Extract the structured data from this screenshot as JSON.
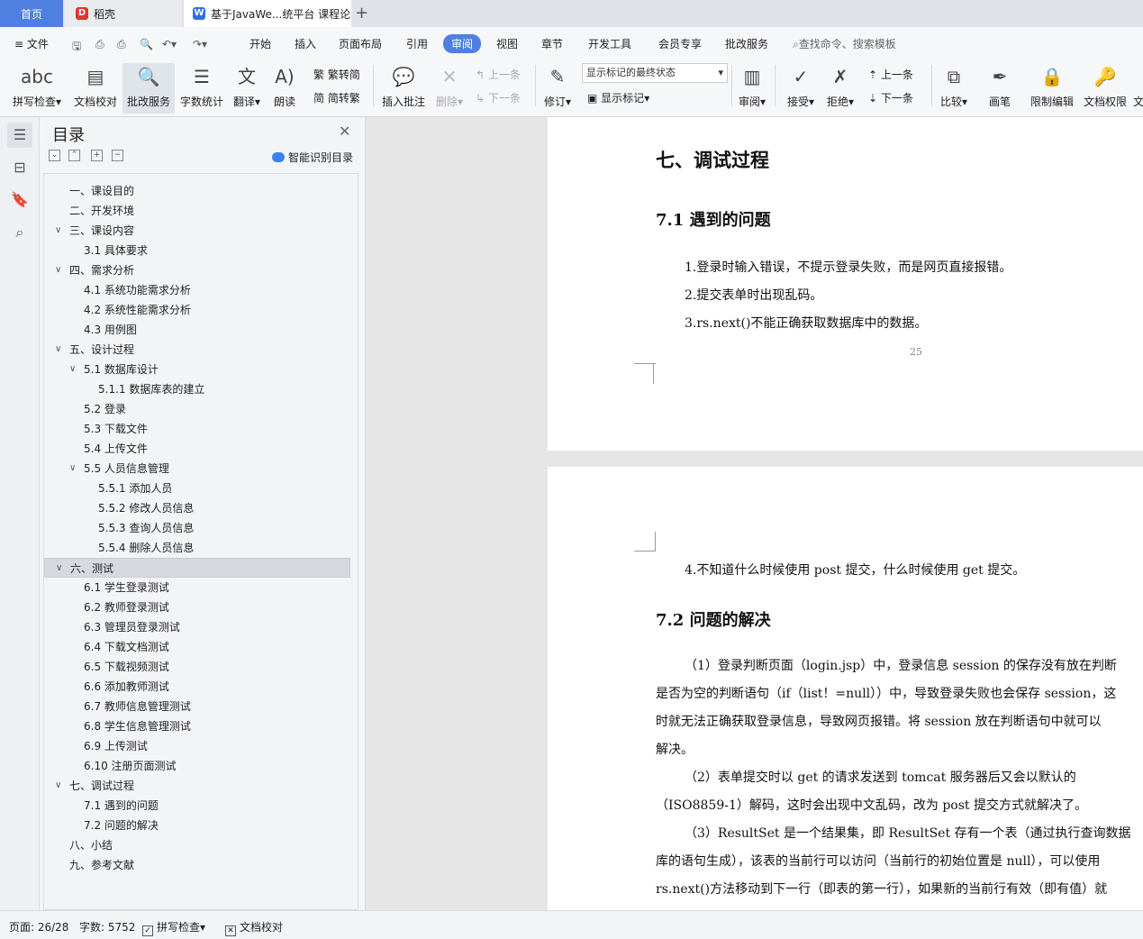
{
  "tabs": {
    "home": "首页",
    "daoke": "稻壳",
    "document": "基于JavaWe...统平台 课程论",
    "new_tab": "+"
  },
  "menu": {
    "file": "文件",
    "items": [
      "开始",
      "插入",
      "页面布局",
      "引用",
      "审阅",
      "视图",
      "章节",
      "开发工具",
      "会员专享",
      "批改服务"
    ],
    "active": "审阅",
    "search_placeholder": "查找命令、搜索模板"
  },
  "ribbon": {
    "spell_check": "拼写检查",
    "doc_proof": "文档校对",
    "correction_service": "批改服务",
    "word_count": "字数统计",
    "translate": "翻译",
    "read_aloud": "朗读",
    "trad_to_simp": "繁转简",
    "simp_to_trad": "简转繁",
    "insert_comment": "插入批注",
    "delete": "删除",
    "prev_item": "上一条",
    "next_item": "下一条",
    "revise": "修订",
    "markup_state": "显示标记的最终状态",
    "show_markup": "显示标记",
    "review": "审阅",
    "accept": "接受",
    "reject": "拒绝",
    "prev": "上一条",
    "next": "下一条",
    "compare": "比较",
    "pen": "画笔",
    "restrict_edit": "限制编辑",
    "doc_permission": "文档权限",
    "cut_off": "文"
  },
  "nav": {
    "title": "目录",
    "smart_toc": "智能识别目录",
    "items": [
      {
        "label": "一、课设目的",
        "level": 1,
        "caret": false
      },
      {
        "label": "二、开发环境",
        "level": 1,
        "caret": false
      },
      {
        "label": "三、课设内容",
        "level": 1,
        "caret": true
      },
      {
        "label": "3.1 具体要求",
        "level": 2,
        "caret": false
      },
      {
        "label": "四、需求分析",
        "level": 1,
        "caret": true
      },
      {
        "label": "4.1 系统功能需求分析",
        "level": 2,
        "caret": false
      },
      {
        "label": "4.2 系统性能需求分析",
        "level": 2,
        "caret": false
      },
      {
        "label": "4.3 用例图",
        "level": 2,
        "caret": false
      },
      {
        "label": "五、设计过程",
        "level": 1,
        "caret": true
      },
      {
        "label": "5.1 数据库设计",
        "level": 2,
        "caret": true
      },
      {
        "label": "5.1.1 数据库表的建立",
        "level": 3,
        "caret": false
      },
      {
        "label": "5.2 登录",
        "level": 2,
        "caret": false
      },
      {
        "label": "5.3 下载文件",
        "level": 2,
        "caret": false
      },
      {
        "label": "5.4 上传文件",
        "level": 2,
        "caret": false
      },
      {
        "label": "5.5 人员信息管理",
        "level": 2,
        "caret": true
      },
      {
        "label": "5.5.1 添加人员",
        "level": 3,
        "caret": false
      },
      {
        "label": "5.5.2 修改人员信息",
        "level": 3,
        "caret": false
      },
      {
        "label": "5.5.3 查询人员信息",
        "level": 3,
        "caret": false
      },
      {
        "label": "5.5.4 删除人员信息",
        "level": 3,
        "caret": false
      },
      {
        "label": "六、测试",
        "level": 1,
        "caret": true,
        "selected": true
      },
      {
        "label": "6.1 学生登录测试",
        "level": 2,
        "caret": false
      },
      {
        "label": "6.2 教师登录测试",
        "level": 2,
        "caret": false
      },
      {
        "label": "6.3 管理员登录测试",
        "level": 2,
        "caret": false
      },
      {
        "label": "6.4 下载文档测试",
        "level": 2,
        "caret": false
      },
      {
        "label": "6.5 下载视频测试",
        "level": 2,
        "caret": false
      },
      {
        "label": "6.6 添加教师测试",
        "level": 2,
        "caret": false
      },
      {
        "label": "6.7 教师信息管理测试",
        "level": 2,
        "caret": false
      },
      {
        "label": "6.8 学生信息管理测试",
        "level": 2,
        "caret": false
      },
      {
        "label": "6.9 上传测试",
        "level": 2,
        "caret": false
      },
      {
        "label": "6.10 注册页面测试",
        "level": 2,
        "caret": false
      },
      {
        "label": "七、调试过程",
        "level": 1,
        "caret": true
      },
      {
        "label": "7.1 遇到的问题",
        "level": 2,
        "caret": false
      },
      {
        "label": "7.2 问题的解决",
        "level": 2,
        "caret": false
      },
      {
        "label": "八、小结",
        "level": 1,
        "caret": false
      },
      {
        "label": "九、参考文献",
        "level": 1,
        "caret": false
      }
    ]
  },
  "document": {
    "page1": {
      "heading": "七、调试过程",
      "subheading": "7.1 遇到的问题",
      "lines": [
        "1.登录时输入错误，不提示登录失败，而是网页直接报错。",
        "2.提交表单时出现乱码。",
        "3.rs.next()不能正确获取数据库中的数据。"
      ],
      "page_number": "25"
    },
    "page2": {
      "line4": "4.不知道什么时候使用 post 提交，什么时候使用 get 提交。",
      "subheading": "7.2 问题的解决",
      "para_lines": [
        "（1）登录判断页面（login.jsp）中，登录信息 session 的保存没有放在判断",
        "是否为空的判断语句（if（list！=null））中，导致登录失败也会保存 session，这",
        "时就无法正确获取登录信息，导致网页报错。将 session 放在判断语句中就可以",
        "解决。",
        "（2）表单提交时以 get 的请求发送到 tomcat 服务器后又会以默认的",
        "（ISO8859-1）解码，这时会出现中文乱码，改为 post 提交方式就解决了。",
        "（3）ResultSet 是一个结果集，即 ResultSet 存有一个表（通过执行查询数据",
        "库的语句生成），该表的当前行可以访问（当前行的初始位置是 null），可以使用",
        "rs.next()方法移动到下一行（即表的第一行），如果新的当前行有效（即有值）就"
      ]
    }
  },
  "status": {
    "page": "页面: 26/28",
    "words": "字数: 5752",
    "spell_check": "拼写检查",
    "doc_proof": "文档校对"
  },
  "colors": {
    "accent": "#4f7fe0",
    "toolbar_bg": "#f6f7f9",
    "selected_toc": "#d6d9df"
  }
}
